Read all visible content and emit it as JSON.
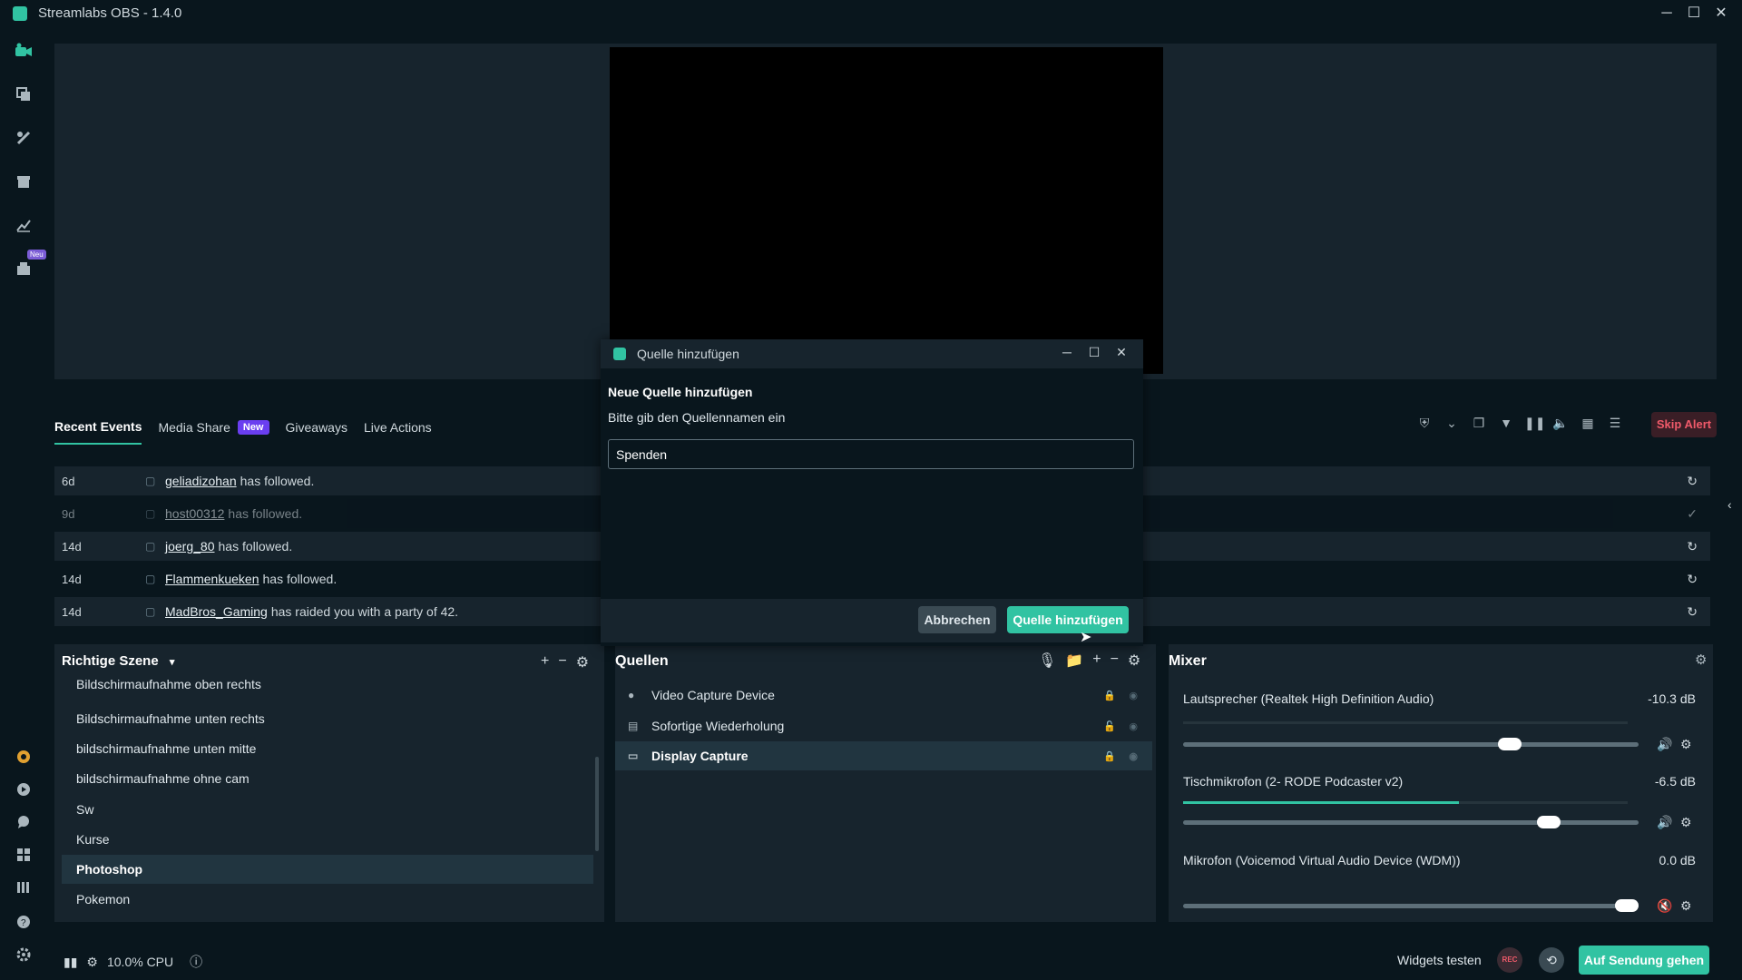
{
  "app": {
    "title": "Streamlabs OBS - 1.4.0",
    "minimize": "─",
    "maximize": "☐",
    "close": "✕"
  },
  "sidebar": {
    "new_badge": "Neu"
  },
  "events": {
    "tabs": [
      "Recent Events",
      "Media Share",
      "Giveaways",
      "Live Actions"
    ],
    "new_badge": "New",
    "skip_alert": "Skip Alert",
    "rows": [
      {
        "time": "6d",
        "name": "geliadizohan",
        "message": "has followed.",
        "action": "↻"
      },
      {
        "time": "9d",
        "name": "host00312",
        "message": "has followed.",
        "action": "✓"
      },
      {
        "time": "14d",
        "name": "joerg_80",
        "message": "has followed.",
        "action": "↻"
      },
      {
        "time": "14d",
        "name": "Flammenkueken",
        "message": "has followed.",
        "action": "↻"
      },
      {
        "time": "14d",
        "name": "MadBros_Gaming",
        "message": "has raided you with a party of 42.",
        "action": "↻"
      }
    ]
  },
  "scenes": {
    "header": "Richtige Szene",
    "items": [
      "Bildschirmaufnahme oben rechts",
      "Bildschirmaufnahme unten rechts",
      "bildschirmaufnahme unten mitte",
      "bildschirmaufnahme ohne cam",
      "Sw",
      "Kurse",
      "Photoshop",
      "Pokemon"
    ]
  },
  "sources": {
    "header": "Quellen",
    "items": [
      "Video Capture Device",
      "Sofortige Wiederholung",
      "Display Capture"
    ]
  },
  "mixer": {
    "header": "Mixer",
    "channels": [
      {
        "name": "Lautsprecher (Realtek High Definition Audio)",
        "db": "-10.3 dB",
        "level": 0.73
      },
      {
        "name": "Tischmikrofon (2- RODE Podcaster v2)",
        "db": "-6.5 dB",
        "level": 0.82
      },
      {
        "name": "Mikrofon (Voicemod Virtual Audio Device (WDM))",
        "db": "0.0 dB",
        "level": 1.0
      }
    ]
  },
  "footer": {
    "cpu": "10.0% CPU",
    "widgets_test": "Widgets testen",
    "rec": "REC",
    "go_live": "Auf Sendung gehen"
  },
  "dialog": {
    "title": "Quelle hinzufügen",
    "heading": "Neue Quelle hinzufügen",
    "prompt": "Bitte gib den Quellennamen ein",
    "input_value": "Spenden",
    "cancel": "Abbrechen",
    "confirm": "Quelle hinzufügen"
  }
}
